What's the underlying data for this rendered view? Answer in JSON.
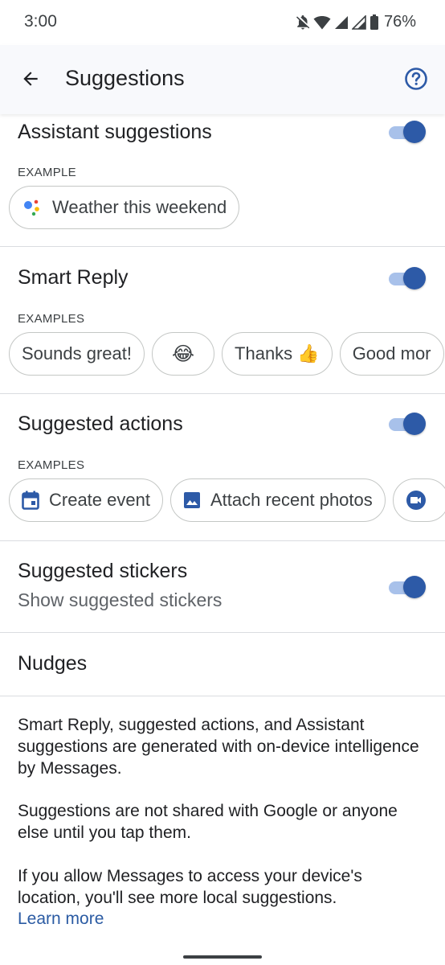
{
  "status_bar": {
    "time": "3:00",
    "battery": "76%"
  },
  "app_bar": {
    "title": "Suggestions"
  },
  "sections": {
    "assistant": {
      "title": "Assistant suggestions",
      "example_label": "EXAMPLE",
      "toggle_on": true,
      "chips": [
        "Weather this weekend"
      ]
    },
    "smart_reply": {
      "title": "Smart Reply",
      "example_label": "EXAMPLES",
      "toggle_on": true,
      "chips": [
        "Sounds great!",
        "😂",
        "Thanks 👍",
        "Good mor"
      ]
    },
    "suggested_actions": {
      "title": "Suggested actions",
      "example_label": "EXAMPLES",
      "toggle_on": true,
      "chips": [
        "Create event",
        "Attach recent photos"
      ]
    },
    "stickers": {
      "title": "Suggested stickers",
      "subtitle": "Show suggested stickers",
      "toggle_on": true
    },
    "nudges": {
      "title": "Nudges"
    }
  },
  "footer": {
    "para1": "Smart Reply, suggested actions, and Assistant suggestions are generated with on-device intelligence by Messages.",
    "para2": "Suggestions are not shared with Google or anyone else until you tap them.",
    "para3": "If you allow Messages to access your device's location, you'll see more local suggestions.",
    "learn_more": "Learn more"
  },
  "colors": {
    "accent": "#2d5aa7",
    "track": "#a8c1ea",
    "link": "#2b5ba3"
  }
}
